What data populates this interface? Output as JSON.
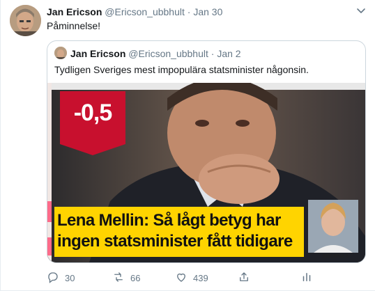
{
  "tweet": {
    "author_name": "Jan Ericson",
    "handle": "@Ericson_ubbhult",
    "separator": "·",
    "date": "Jan 30",
    "text": "Påminnelse!",
    "more_icon": "chevron-down-icon"
  },
  "quoted": {
    "author_name": "Jan Ericson",
    "handle": "@Ericson_ubbhult",
    "separator": "·",
    "date": "Jan 2",
    "text": "Tydligen Sveriges mest impopulära statsminister någonsin.",
    "image": {
      "badge": "-0,5",
      "headline_line1": "Lena Mellin: Så lågt betyg har",
      "headline_line2": "ingen statsminister fått tidigare",
      "corner_caption": "SIDORNA 6-"
    }
  },
  "actions": {
    "reply_count": "30",
    "retweet_count": "66",
    "like_count": "439",
    "icons": [
      "reply-icon",
      "retweet-icon",
      "like-icon",
      "share-icon",
      "analytics-icon"
    ]
  },
  "colors": {
    "badge_red": "#c8102e",
    "headline_yellow": "#ffd400",
    "meta_gray": "#657786",
    "border": "#ccd6dd"
  }
}
